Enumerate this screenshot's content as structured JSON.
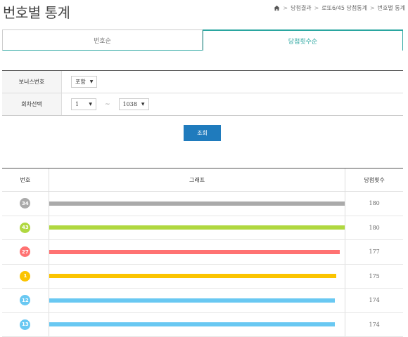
{
  "page": {
    "title": "번호별 통계"
  },
  "breadcrumb": {
    "items": [
      "당첨결과",
      "로또6/45 당첨통계",
      "번호별 통계"
    ]
  },
  "tabs": [
    {
      "label": "번호순",
      "active": false
    },
    {
      "label": "당첨횟수순",
      "active": true
    }
  ],
  "form": {
    "bonus_label": "보너스번호",
    "bonus_value": "포함",
    "round_label": "회차선택",
    "round_from": "1",
    "round_tilde": "~",
    "round_to": "1038",
    "submit_label": "조회"
  },
  "table": {
    "headers": [
      "번호",
      "그래프",
      "당첨횟수"
    ],
    "max": 180,
    "rows": [
      {
        "number": "34",
        "count": 180,
        "color": "#aaaaaa"
      },
      {
        "number": "43",
        "count": 180,
        "color": "#b0d840"
      },
      {
        "number": "27",
        "count": 177,
        "color": "#ff7272"
      },
      {
        "number": "1",
        "count": 175,
        "color": "#fbc400"
      },
      {
        "number": "12",
        "count": 174,
        "color": "#69c8f2"
      },
      {
        "number": "13",
        "count": 174,
        "color": "#69c8f2"
      }
    ]
  },
  "colors": {
    "accent": "#2aa6a0",
    "button": "#1f7bbd"
  },
  "icons": {
    "home": "home-icon"
  }
}
